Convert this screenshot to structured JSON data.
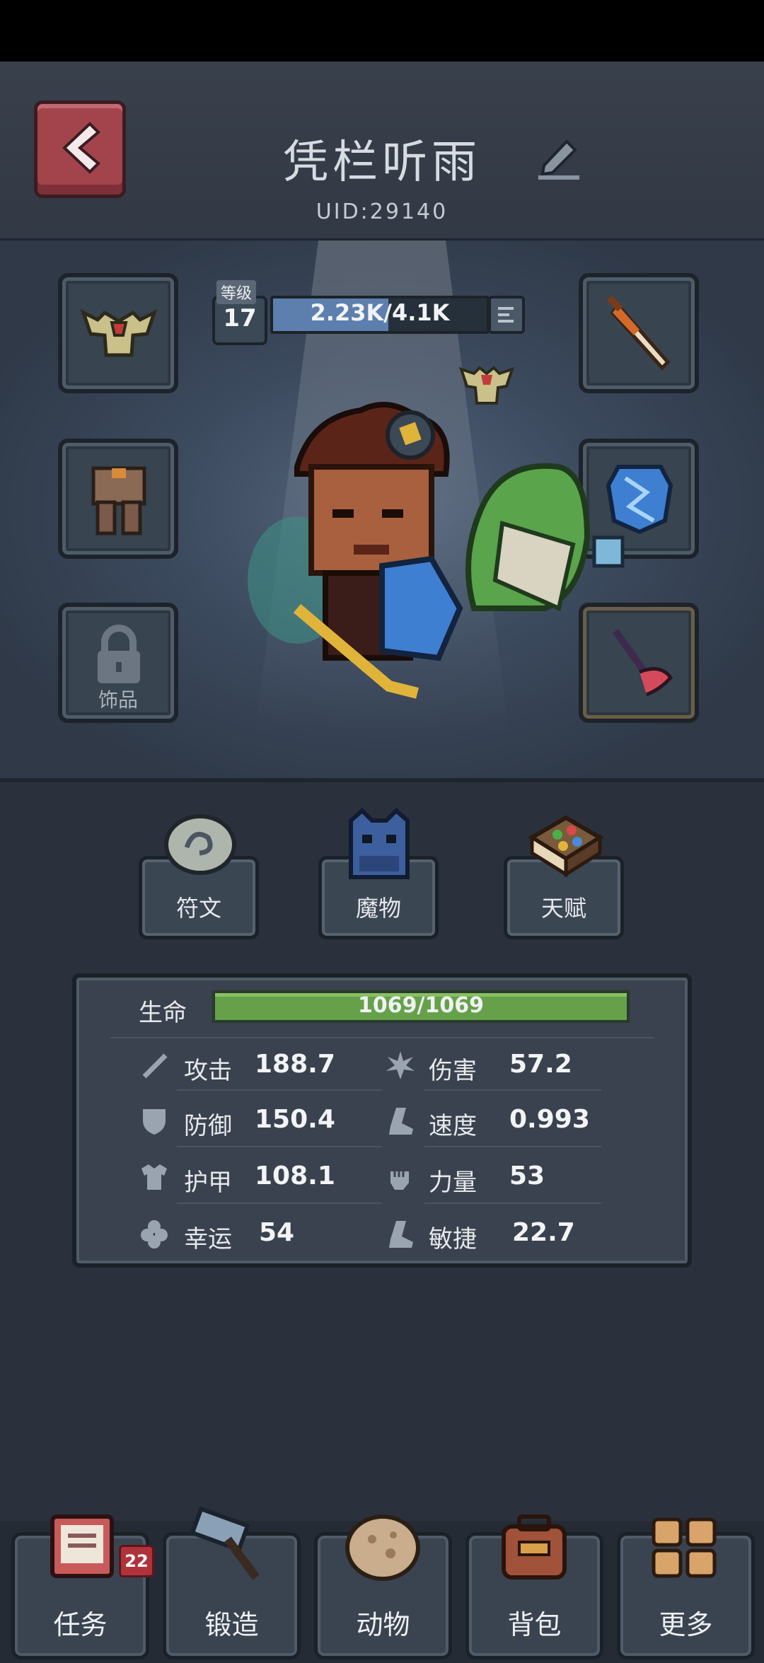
{
  "header": {
    "title": "凭栏听雨",
    "uid": "UID:29140"
  },
  "level": {
    "tag": "等级",
    "value": "17",
    "xp_text": "2.23K/4.1K",
    "xp_fraction": 0.54
  },
  "equipment": {
    "accessory_label": "饰品"
  },
  "features": [
    {
      "label": "符文"
    },
    {
      "label": "魔物"
    },
    {
      "label": "天赋"
    }
  ],
  "hp": {
    "label": "生命",
    "value": "1069/1069",
    "fraction": 1.0
  },
  "stats": [
    {
      "name": "攻击",
      "value": "188.7",
      "icon": "sword-icon"
    },
    {
      "name": "伤害",
      "value": "57.2",
      "icon": "burst-icon"
    },
    {
      "name": "防御",
      "value": "150.4",
      "icon": "shield-icon"
    },
    {
      "name": "速度",
      "value": "0.993",
      "icon": "boot-icon"
    },
    {
      "name": "护甲",
      "value": "108.1",
      "icon": "armor-icon"
    },
    {
      "name": "力量",
      "value": "53",
      "icon": "fist-icon"
    },
    {
      "name": "幸运",
      "value": "54",
      "icon": "clover-icon"
    },
    {
      "name": "敏捷",
      "value": "22.7",
      "icon": "boot-icon"
    }
  ],
  "nav": [
    {
      "label": "任务",
      "badge": "22"
    },
    {
      "label": "锻造"
    },
    {
      "label": "动物"
    },
    {
      "label": "背包"
    },
    {
      "label": "更多"
    }
  ],
  "colors": {
    "back_button": "#a3444d",
    "hp_bar": "#66a14a",
    "xp_bar": "#5d7fae",
    "badge": "#b0323a"
  }
}
